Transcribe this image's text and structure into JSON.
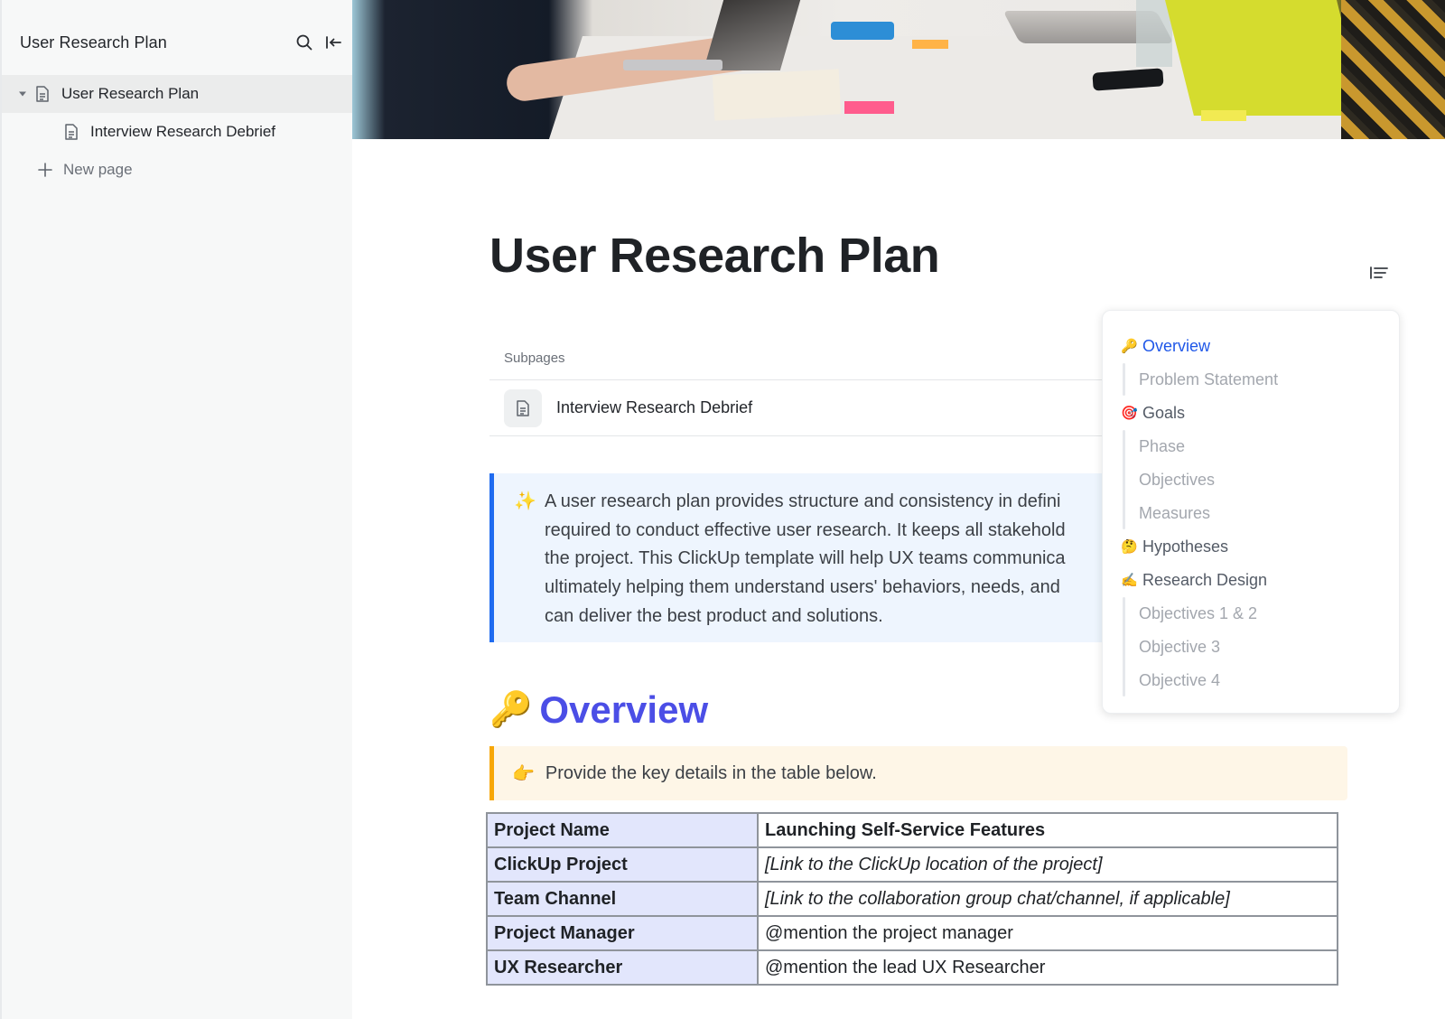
{
  "sidebar": {
    "title": "User Research Plan",
    "icons": {
      "search": "search-icon",
      "collapse": "collapse-sidebar-icon"
    },
    "items": [
      {
        "label": "User Research Plan",
        "icon": "document-icon",
        "expanded": true,
        "active": true
      },
      {
        "label": "Interview Research Debrief",
        "icon": "document-icon",
        "active": false
      }
    ],
    "new_page_label": "New page"
  },
  "page": {
    "title": "User Research Plan",
    "subpages": {
      "label": "Subpages",
      "items": [
        {
          "label": "Interview Research Debrief",
          "icon": "document-icon"
        }
      ]
    },
    "intro_callout": {
      "emoji": "✨",
      "text": "A user research plan provides structure and consistency in defini\nrequired to conduct effective user research. It keeps all stakehold\nthe project. This ClickUp template will help UX teams communica\nultimately helping them understand users' behaviors, needs, and\ncan deliver the best product and solutions.",
      "accent": "#1f6bf0",
      "background": "#eef5fe"
    },
    "overview_section": {
      "emoji": "🔑",
      "heading": "Overview",
      "heading_color": "#4b4ee6",
      "callout": {
        "emoji": "👉",
        "text": "Provide the key details in the table below.",
        "accent": "#f7a707",
        "background": "#fef6e7"
      },
      "table": {
        "rows": [
          {
            "key": "Project Name",
            "value": "Launching Self-Service Features",
            "style": "bold"
          },
          {
            "key": "ClickUp Project",
            "value": "[Link to the ClickUp location of the project]",
            "style": "italic"
          },
          {
            "key": "Team Channel",
            "value": "[Link to the collaboration group chat/channel, if applicable]",
            "style": "italic"
          },
          {
            "key": "Project Manager",
            "value": "@mention the project manager",
            "style": "normal"
          },
          {
            "key": "UX Researcher",
            "value": "@mention the lead UX Researcher",
            "style": "normal"
          }
        ]
      }
    }
  },
  "toc": {
    "toggle_icon": "table-of-contents-icon",
    "items": [
      {
        "label": "Overview",
        "emoji": "🔑",
        "level": 1,
        "active": true
      },
      {
        "label": "Problem Statement",
        "level": 2
      },
      {
        "label": "Goals",
        "emoji": "🎯",
        "level": 1
      },
      {
        "label": "Phase",
        "level": 2
      },
      {
        "label": "Objectives",
        "level": 2
      },
      {
        "label": "Measures",
        "level": 2
      },
      {
        "label": "Hypotheses",
        "emoji": "🤔",
        "level": 1
      },
      {
        "label": "Research Design",
        "emoji": "✍️",
        "level": 1
      },
      {
        "label": "Objectives 1 & 2",
        "level": 2
      },
      {
        "label": "Objective 3",
        "level": 2
      },
      {
        "label": "Objective 4",
        "level": 2
      }
    ],
    "active_color": "#1f57e8"
  }
}
